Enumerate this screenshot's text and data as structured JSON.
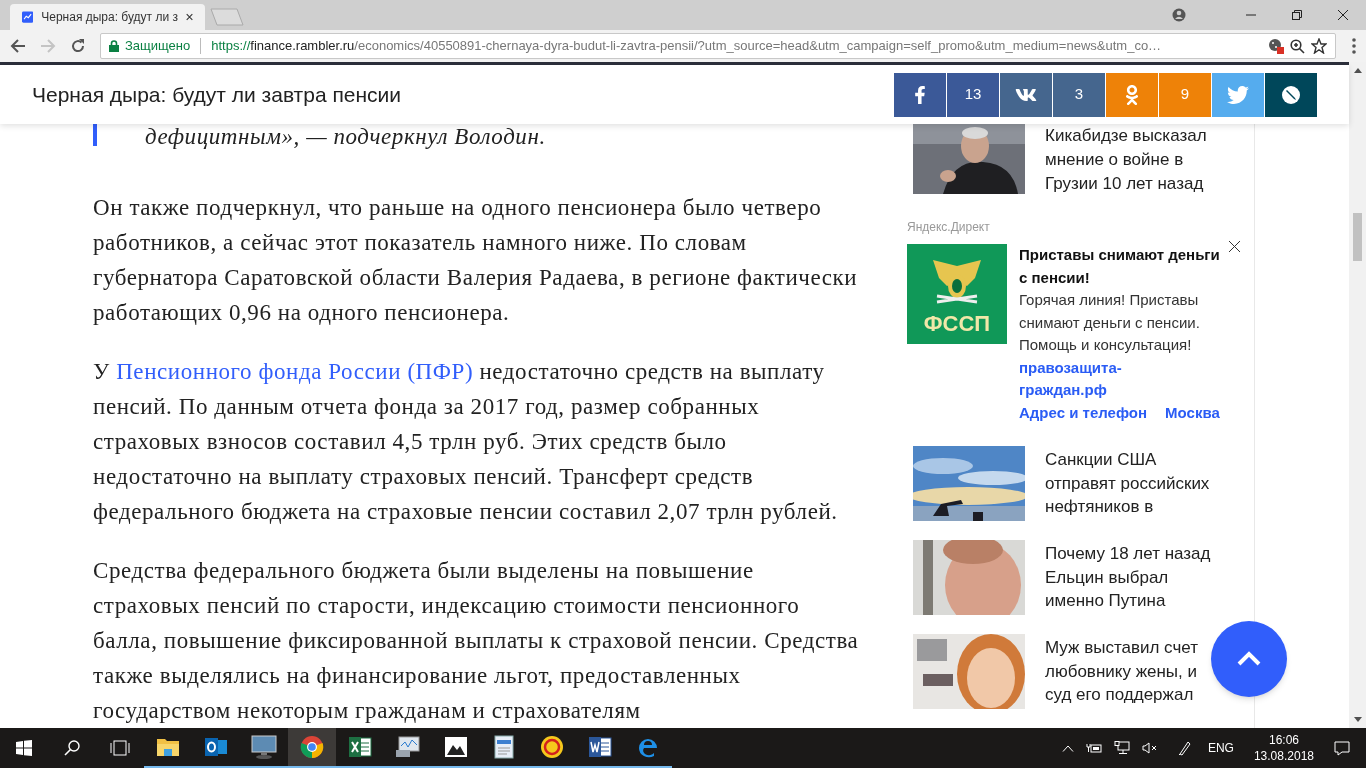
{
  "browser": {
    "tabs": [
      {
        "title": "Черная дыра: будут ли з",
        "selected": true
      }
    ],
    "address": {
      "secure_label": "Защищено",
      "scheme": "https://",
      "host": "finance.rambler.ru",
      "path": "/economics/40550891-chernaya-dyra-budut-li-zavtra-pensii/?utm_source=head&utm_campaign=self_promo&utm_medium=news&utm_co…"
    }
  },
  "header": {
    "title": "Черная дыра: будут ли завтра пенсии",
    "share": [
      {
        "kind": "facebook",
        "color": "#3b5998"
      },
      {
        "kind": "count",
        "text": "13",
        "color": "#3b5998"
      },
      {
        "kind": "vk",
        "color": "#45668e"
      },
      {
        "kind": "count",
        "text": "3",
        "color": "#45668e"
      },
      {
        "kind": "odnoklassniki",
        "color": "#ee8208"
      },
      {
        "kind": "count",
        "text": "9",
        "color": "#ee8208"
      },
      {
        "kind": "twitter",
        "color": "#55acee"
      },
      {
        "kind": "link",
        "color": "#00475a"
      }
    ]
  },
  "article": {
    "quote": "дефицитным», — подчеркнул Володин.",
    "paragraphs": [
      {
        "text": "Он также подчеркнул, что раньше на одного пенсионера было четверо работников, а сейчас этот показатель намного ниже. По словам губернатора Саратовской области Валерия Радаева, в регионе фактически работающих 0,96 на одного пенсионера."
      },
      {
        "prefix": "У ",
        "link": "Пенсионного фонда России (ПФР)",
        "text": " недостаточно средств на выплату пенсий. По данным отчета фонда за 2017 год, размер собранных страховых взносов составил 4,5 трлн руб. Этих средств было недостаточно на выплату страховых пенсий. Трансферт средств федерального бюджета на страховые пенсии составил 2,07 трлн рублей."
      },
      {
        "text": "Средства федерального бюджета были выделены на повышение страховых пенсий по старости, индексацию стоимости пенсионного балла, повышение фиксированной выплаты к страховой пенсии. Средства также выделялись на финансирование льгот, предоставленных государством некоторым гражданам и страхователям"
      }
    ]
  },
  "sidebar": {
    "top_news": {
      "title": "Кикабидзе высказал мнение о войне в Грузии 10 лет назад"
    },
    "ad": {
      "label": "Яндекс.Директ",
      "logo_text": "ФССП",
      "title": "Приставы снимают деньги с пенсии!",
      "text": "Горячая линия! Приставы снимают деньги с пенсии. Помощь и консультация!",
      "link": "правозащита-граждан.рф",
      "contacts_link": "Адрес и телефон",
      "city_link": "Москва"
    },
    "news": [
      {
        "title": "Санкции США отправят российских нефтяников в",
        "kind": "landscape"
      },
      {
        "title": "Почему 18 лет назад Ельцин выбрал именно Путина",
        "kind": "man"
      },
      {
        "title": "Муж выставил счет любовнику жены, и суд его поддержал",
        "kind": "woman"
      }
    ]
  },
  "taskbar": {
    "apps": [
      {
        "kind": "folder",
        "selected": false
      },
      {
        "kind": "outlook",
        "selected": false
      },
      {
        "kind": "monitor",
        "selected": false
      },
      {
        "kind": "chrome",
        "selected": true
      },
      {
        "kind": "excel",
        "selected": false
      },
      {
        "kind": "perfmon",
        "selected": false
      },
      {
        "kind": "photos",
        "selected": false
      },
      {
        "kind": "reader",
        "selected": false
      },
      {
        "kind": "onec",
        "selected": false
      },
      {
        "kind": "word",
        "selected": false
      },
      {
        "kind": "edge",
        "selected": false
      }
    ],
    "language": "ENG",
    "time": "16:06",
    "date": "13.08.2018"
  }
}
